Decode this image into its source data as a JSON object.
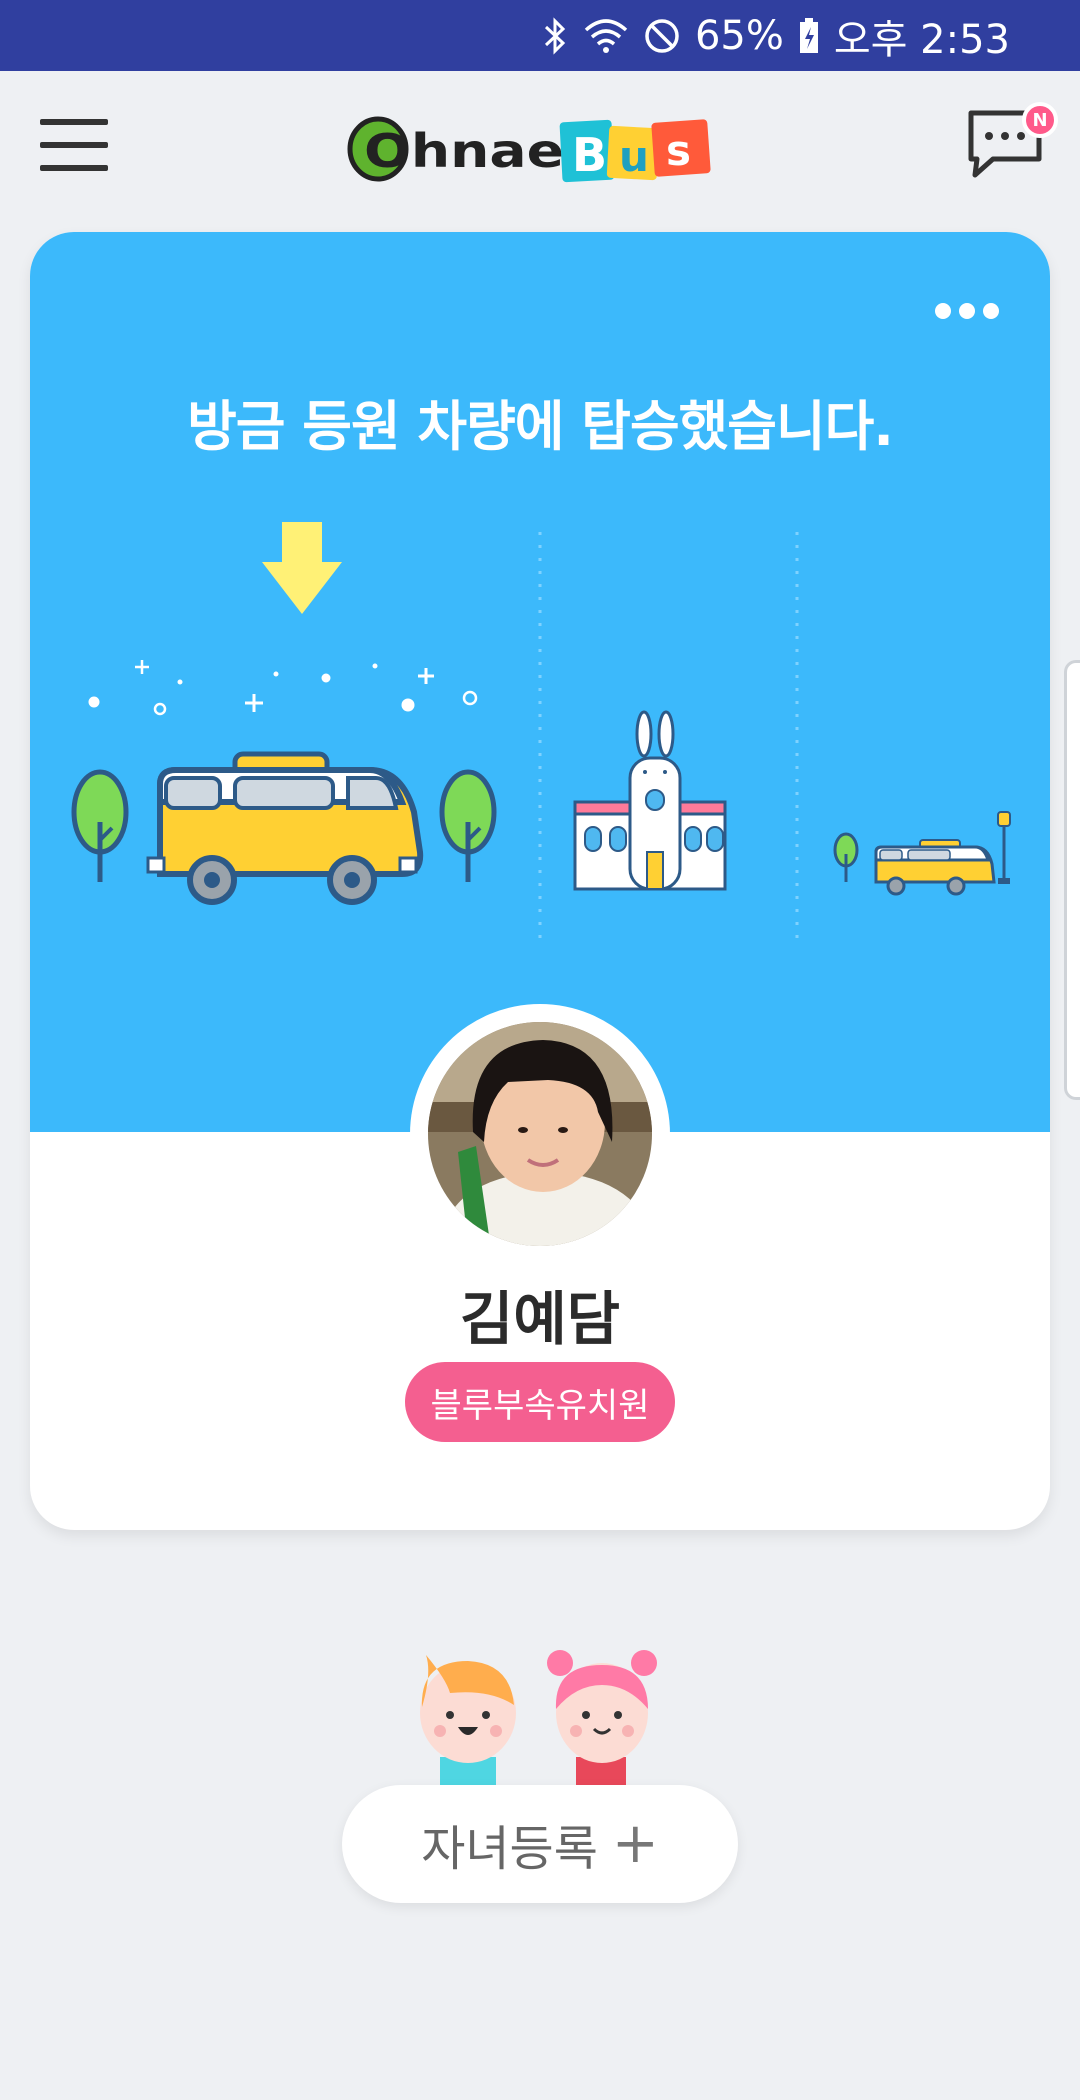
{
  "status_bar": {
    "battery": "65%",
    "time": "오후 2:53",
    "icons": [
      "bluetooth-icon",
      "wifi-icon",
      "do-not-disturb-icon",
      "battery-charging-icon"
    ]
  },
  "header": {
    "logo_left": "Ohnae",
    "logo_letters": [
      "B",
      "u",
      "s"
    ],
    "message_badge": "N"
  },
  "card": {
    "status_message": "방금 등원 차량에 탑승했습니다.",
    "child_name": "김예담",
    "school_name": "블루부속유치원"
  },
  "add_child": {
    "label": "자녀등록",
    "plus": "+"
  },
  "colors": {
    "status_bar": "#303f9f",
    "card_top": "#3cb9fb",
    "school_badge": "#f45f90",
    "bus_yellow": "#ffd033",
    "arrow_yellow": "#fff176"
  }
}
